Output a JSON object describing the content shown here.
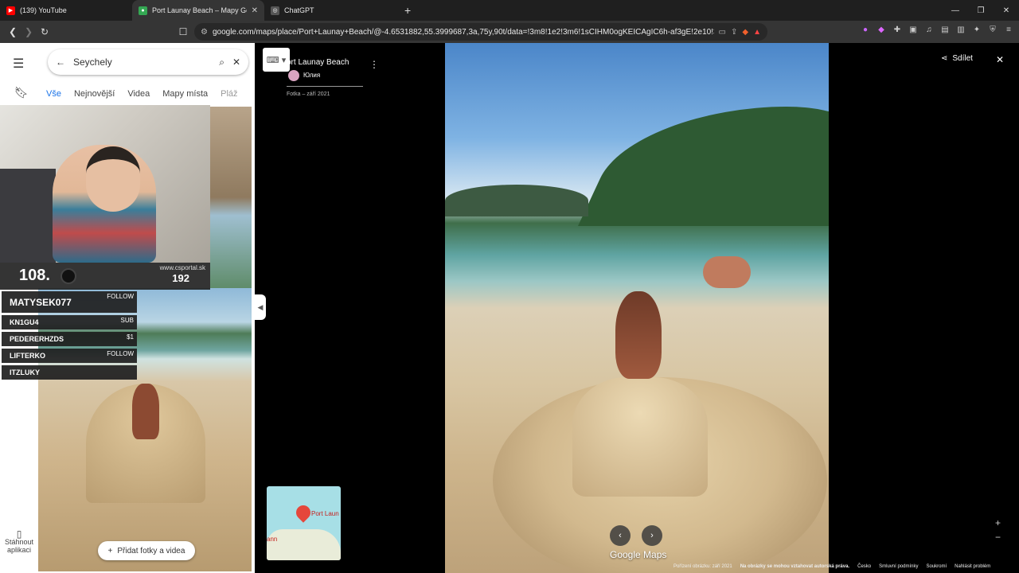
{
  "browser": {
    "tabs": [
      {
        "title": "(139) YouTube",
        "favicon": "youtube-icon",
        "color": "#ff0000"
      },
      {
        "title": "Port Launay Beach – Mapy Goog",
        "favicon": "maps-pin-icon",
        "color": "#34a853"
      },
      {
        "title": "ChatGPT",
        "favicon": "chatgpt-icon",
        "color": "#555555"
      }
    ],
    "url": "google.com/maps/place/Port+Launay+Beach/@-4.6531882,55.3999687,3a,75y,90t/data=!3m8!1e2!3m6!1sCIHM0ogKEICAgIC6h-af3gE!2e10!3e..."
  },
  "maps": {
    "search_query": "Seychely",
    "chips": [
      "Vše",
      "Nejnovější",
      "Videa",
      "Mapy místa",
      "Pláž"
    ],
    "add_photos_label": "Přidat fotky a videa",
    "download_label_1": "Stáhnout",
    "download_label_2": "aplikaci"
  },
  "overlay": {
    "rank": "108.",
    "site": "www.csportal.sk",
    "points": "192",
    "rows": [
      {
        "name": "MATYSEK077",
        "tag": "FOLLOW"
      },
      {
        "name": "KN1GU4",
        "tag": "SUB"
      },
      {
        "name": "PEDERERHZDS",
        "tag": "$1"
      },
      {
        "name": "LIFTERKO",
        "tag": "FOLLOW"
      },
      {
        "name": "ITZLUKY",
        "tag": ""
      }
    ]
  },
  "viewer": {
    "title": "ort Launay Beach",
    "author": "Юлия",
    "photo_date": "Fotka – září 2021",
    "share_label": "Sdílet",
    "minimap_label": "Port Laun",
    "minimap_label2": "ann",
    "logo": "Google Maps",
    "footer": [
      "Pořízení obrázku: září 2021",
      "Na obrázky se mohou vztahovat autorská práva.",
      "Česko",
      "Smluvní podmínky",
      "Soukromí",
      "Nahlásit problém"
    ]
  }
}
